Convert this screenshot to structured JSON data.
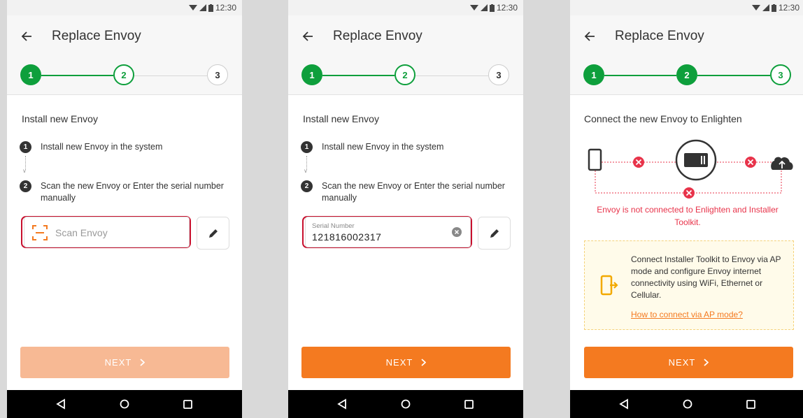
{
  "status": {
    "time": "12:30"
  },
  "app": {
    "title": "Replace Envoy",
    "back_icon": "arrow-left-icon"
  },
  "steps": [
    "1",
    "2",
    "3"
  ],
  "colors": {
    "green": "#0e9f3c",
    "orange": "#f47a20",
    "orange_disabled": "#f7b994",
    "red": "#e8334a"
  },
  "screen1": {
    "heading": "Install new Envoy",
    "tasks": [
      {
        "num": "1",
        "text": "Install new Envoy in the system"
      },
      {
        "num": "2",
        "text": "Scan the new Envoy or Enter the serial number manually"
      }
    ],
    "scan_placeholder": "Scan Envoy",
    "next_label": "NEXT"
  },
  "screen2": {
    "heading": "Install new Envoy",
    "tasks": [
      {
        "num": "1",
        "text": "Install new Envoy in the system"
      },
      {
        "num": "2",
        "text": "Scan the new Envoy or Enter the serial number manually"
      }
    ],
    "serial_label": "Serial Number",
    "serial_value": "121816002317",
    "next_label": "NEXT"
  },
  "screen3": {
    "heading": "Connect the new Envoy to Enlighten",
    "error_text": "Envoy is not connected to Enlighten and Installer Toolkit.",
    "info_text": "Connect Installer Toolkit to Envoy via AP mode and configure Envoy internet connectivity using WiFi, Ethernet or Cellular.",
    "info_link": "How to connect via AP mode?",
    "next_label": "NEXT"
  }
}
